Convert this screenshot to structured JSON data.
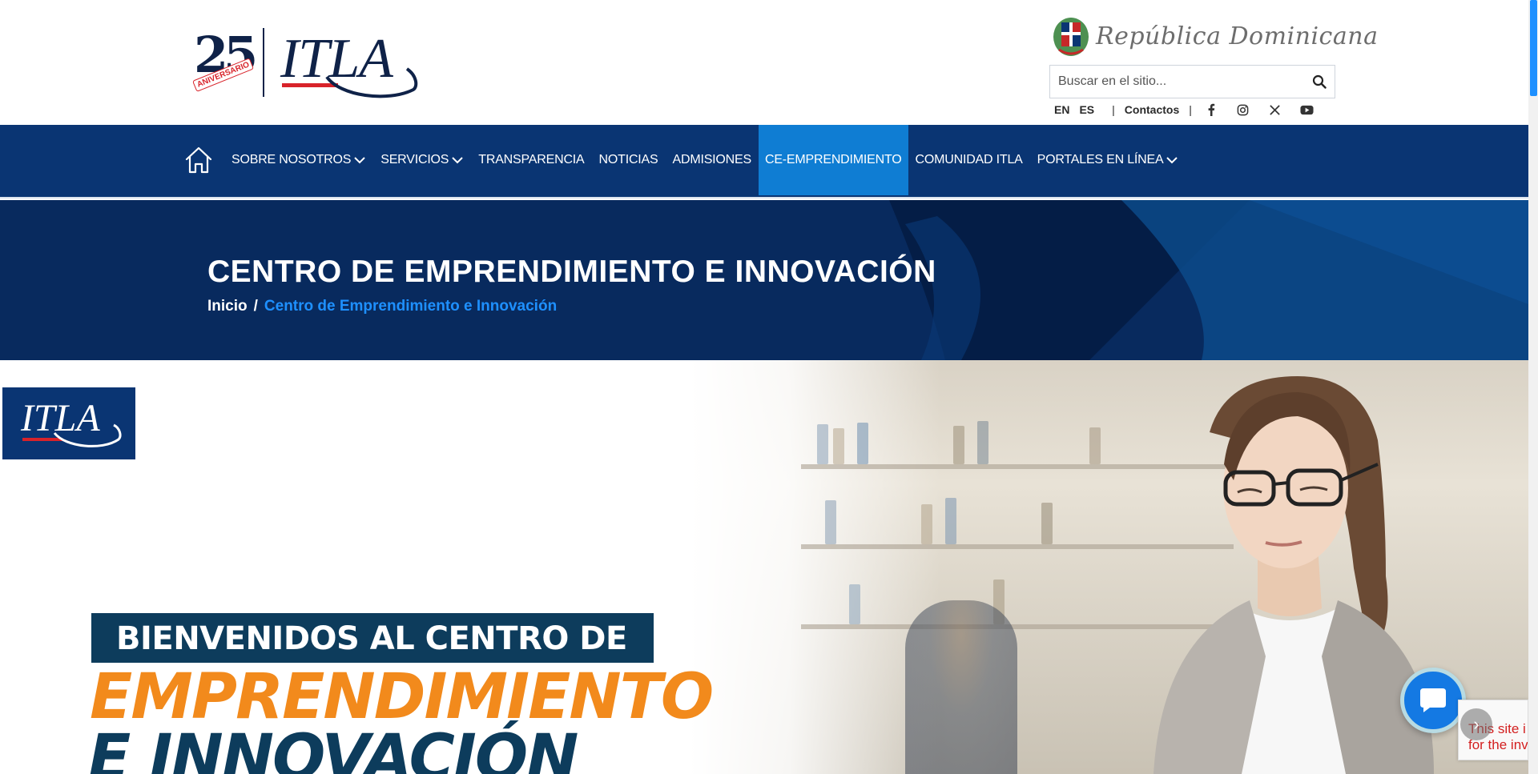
{
  "header": {
    "logo_anniversary_number": "25",
    "logo_anniversary_ribbon": "ANIVERSARIO",
    "logo_text": "ITLA",
    "government_label": "República Dominicana"
  },
  "search": {
    "placeholder": "Buscar en el sitio..."
  },
  "utility": {
    "lang_en": "EN",
    "lang_es": "ES",
    "contact_label": "Contactos",
    "social_icons": [
      "facebook-icon",
      "instagram-icon",
      "x-icon",
      "youtube-icon"
    ]
  },
  "nav": {
    "items": [
      {
        "label": "SOBRE NOSOTROS",
        "has_dropdown": true
      },
      {
        "label": "SERVICIOS",
        "has_dropdown": true
      },
      {
        "label": "TRANSPARENCIA",
        "has_dropdown": false
      },
      {
        "label": "NOTICIAS",
        "has_dropdown": false
      },
      {
        "label": "ADMISIONES",
        "has_dropdown": false
      },
      {
        "label": "CE-EMPRENDIMIENTO",
        "has_dropdown": false,
        "active": true
      },
      {
        "label": "COMUNIDAD ITLA",
        "has_dropdown": false
      },
      {
        "label": "PORTALES EN LÍNEA",
        "has_dropdown": true
      }
    ]
  },
  "page": {
    "title": "CENTRO DE EMPRENDIMIENTO E INNOVACIÓN",
    "breadcrumb": {
      "home": "Inicio",
      "separator": "/",
      "current": "Centro de Emprendimiento e Innovación"
    }
  },
  "hero": {
    "mini_logo": "ITLA",
    "line1": "BIENVENIDOS AL CENTRO DE",
    "line2": "EMPRENDIMIENTO",
    "line3": "E INNOVACIÓN"
  },
  "recaptcha": {
    "line1": "This site i",
    "line2": "for the inv",
    "arrow": "›"
  },
  "colors": {
    "nav_bg": "#0a3573",
    "nav_active": "#0f7dd3",
    "band_bg": "#082a5e",
    "breadcrumb_current": "#1e90ff",
    "accent_orange": "#f28a1c",
    "brand_red": "#d8232a",
    "chat_blue": "#1479e3"
  }
}
